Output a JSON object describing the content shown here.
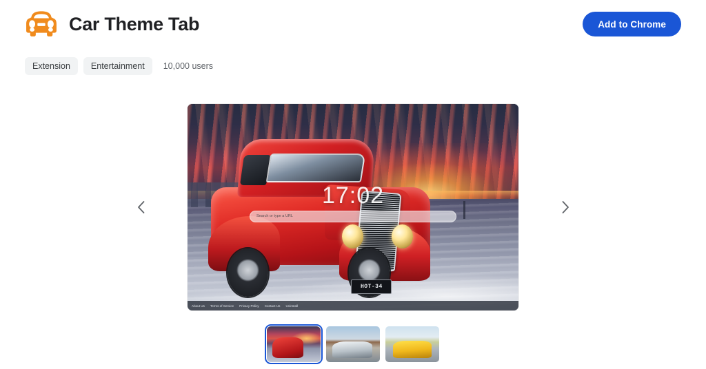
{
  "header": {
    "app_icon": "car-front-icon",
    "app_icon_color": "#f08b1d",
    "title": "Car Theme Tab",
    "cta_label": "Add to Chrome",
    "cta_color": "#1a56d6"
  },
  "meta": {
    "chips": [
      {
        "label": "Extension"
      },
      {
        "label": "Entertainment"
      }
    ],
    "users": "10,000 users"
  },
  "carousel": {
    "prev_icon": "chevron-left-icon",
    "next_icon": "chevron-right-icon",
    "active_index": 0,
    "hero": {
      "alt": "Red classic hot rod coupe on a beach at sunset",
      "clock": "17:02",
      "search_placeholder": "Search or type a URL",
      "license_plate": "HOT-34",
      "footer_links": [
        "About Us",
        "Terms of Service",
        "Privacy Policy",
        "Contact Us",
        "Uninstall"
      ]
    },
    "thumbnails": [
      {
        "alt": "Red classic hot rod on beach at sunset",
        "selected": true
      },
      {
        "alt": "Silver Mercedes-AMG GT sports car",
        "selected": false
      },
      {
        "alt": "Yellow Mercedes-AMG GT sports car",
        "selected": false
      }
    ]
  }
}
